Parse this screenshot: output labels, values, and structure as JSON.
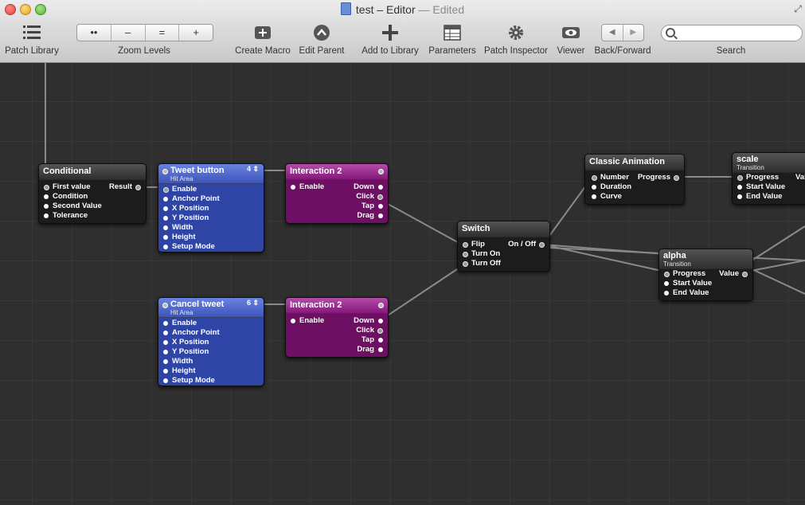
{
  "window": {
    "title": "test",
    "separator": "–",
    "mode": "Editor",
    "status": "— Edited"
  },
  "toolbar": {
    "patch_library": "Patch Library",
    "zoom_levels": "Zoom Levels",
    "zoom_buttons": [
      "••",
      "–",
      "=",
      "+"
    ],
    "create_macro": "Create Macro",
    "edit_parent": "Edit Parent",
    "add_to_library": "Add to Library",
    "parameters": "Parameters",
    "patch_inspector": "Patch Inspector",
    "viewer": "Viewer",
    "back_forward": "Back/Forward",
    "search": "Search",
    "search_value": ""
  },
  "patches": {
    "conditional": {
      "title": "Conditional",
      "inputs": [
        "First value",
        "Condition",
        "Second Value",
        "Tolerance"
      ],
      "outputs": [
        "Result"
      ]
    },
    "tweet_button": {
      "title": "Tweet button",
      "subtitle": "Hit Area",
      "count": "4",
      "inputs": [
        "Enable",
        "Anchor Point",
        "X Position",
        "Y Position",
        "Width",
        "Height",
        "Setup Mode"
      ]
    },
    "interaction_1": {
      "title": "Interaction 2",
      "inputs": [
        "Enable"
      ],
      "outputs": [
        "Down",
        "Click",
        "Tap",
        "Drag"
      ]
    },
    "cancel_tweet": {
      "title": "Cancel tweet",
      "subtitle": "Hit Area",
      "count": "6",
      "inputs": [
        "Enable",
        "Anchor Point",
        "X Position",
        "Y Position",
        "Width",
        "Height",
        "Setup Mode"
      ]
    },
    "interaction_2": {
      "title": "Interaction 2",
      "inputs": [
        "Enable"
      ],
      "outputs": [
        "Down",
        "Click",
        "Tap",
        "Drag"
      ]
    },
    "switch": {
      "title": "Switch",
      "inputs": [
        "Flip",
        "Turn On",
        "Turn Off"
      ],
      "outputs": [
        "On / Off"
      ]
    },
    "classic_animation": {
      "title": "Classic Animation",
      "inputs": [
        "Number",
        "Duration",
        "Curve"
      ],
      "outputs": [
        "Progress"
      ]
    },
    "alpha": {
      "title": "alpha",
      "subtitle": "Transition",
      "inputs": [
        "Progress",
        "Start Value",
        "End Value"
      ],
      "outputs": [
        "Value"
      ]
    },
    "scale": {
      "title": "scale",
      "subtitle": "Transition",
      "inputs": [
        "Progress",
        "Start Value",
        "End Value"
      ],
      "outputs": [
        "Val"
      ]
    }
  }
}
